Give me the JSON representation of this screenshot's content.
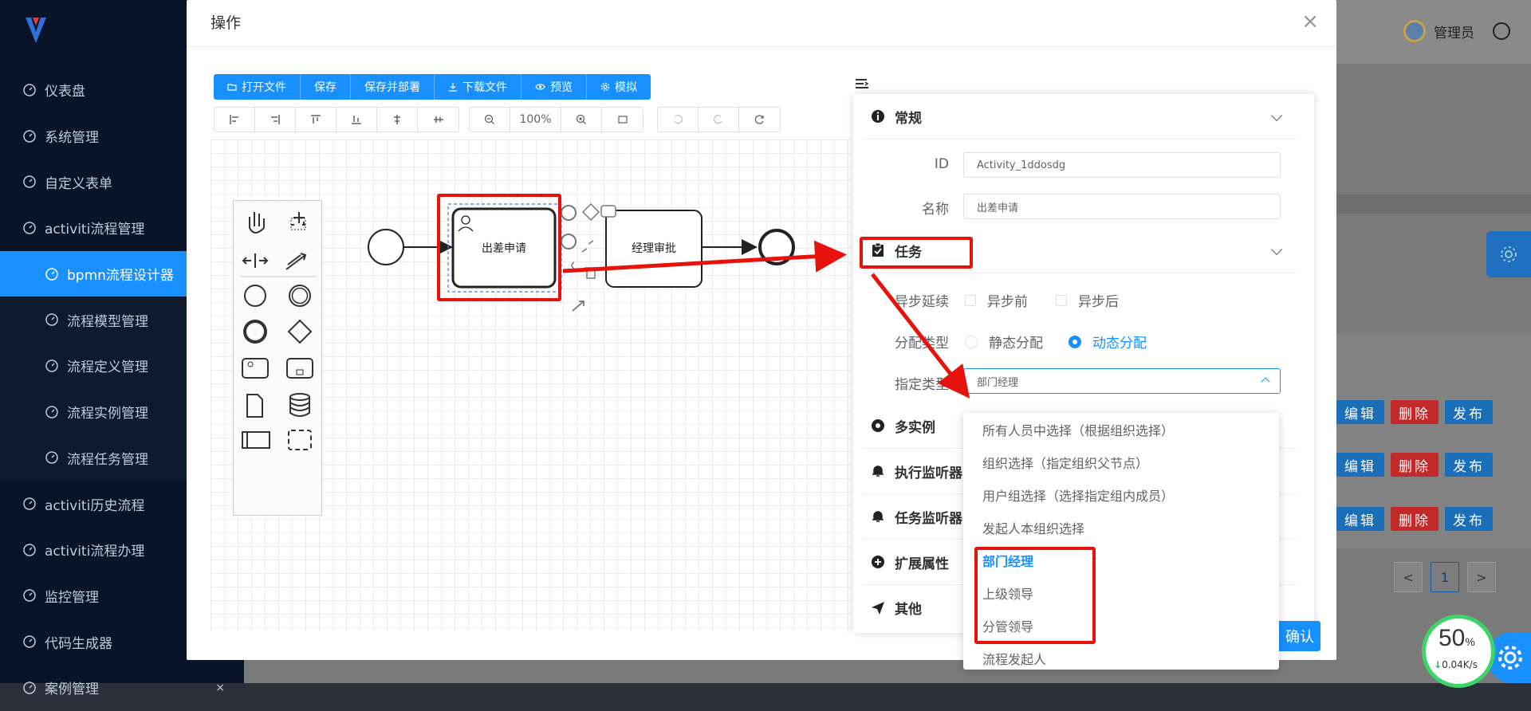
{
  "sidebar": {
    "items": [
      {
        "label": "仪表盘",
        "sub": false,
        "active": false
      },
      {
        "label": "系统管理",
        "sub": false,
        "active": false
      },
      {
        "label": "自定义表单",
        "sub": false,
        "active": false
      },
      {
        "label": "activiti流程管理",
        "sub": false,
        "active": false
      },
      {
        "label": "bpmn流程设计器",
        "sub": true,
        "active": true
      },
      {
        "label": "流程模型管理",
        "sub": true,
        "active": false
      },
      {
        "label": "流程定义管理",
        "sub": true,
        "active": false
      },
      {
        "label": "流程实例管理",
        "sub": true,
        "active": false
      },
      {
        "label": "流程任务管理",
        "sub": true,
        "active": false
      },
      {
        "label": "activiti历史流程",
        "sub": false,
        "active": false
      },
      {
        "label": "activiti流程办理",
        "sub": false,
        "active": false
      },
      {
        "label": "监控管理",
        "sub": false,
        "active": false
      },
      {
        "label": "代码生成器",
        "sub": false,
        "active": false
      },
      {
        "label": "案例管理",
        "sub": false,
        "active": false
      }
    ]
  },
  "header": {
    "user": "管理员"
  },
  "table_actions": {
    "edit": "编辑",
    "delete": "删除",
    "publish": "发布"
  },
  "pager": {
    "current": "1",
    "prev": "<",
    "next": ">"
  },
  "modal": {
    "title": "操作",
    "close": "×",
    "confirm_label": "确认"
  },
  "toolbar": {
    "open_file": "打开文件",
    "save": "保存",
    "save_deploy": "保存并部署",
    "download": "下载文件",
    "preview": "预览",
    "simulate": "模拟",
    "zoom": "100%"
  },
  "diagram": {
    "task1": "出差申请",
    "task2": "经理审批"
  },
  "panel": {
    "general": {
      "title": "常规",
      "id_label": "ID",
      "id_value": "Activity_1ddosdg",
      "name_label": "名称",
      "name_value": "出差申请"
    },
    "task": {
      "title": "任务",
      "async_label": "异步延续",
      "async_before": "异步前",
      "async_after": "异步后",
      "assign_label": "分配类型",
      "static": "静态分配",
      "dynamic": "动态分配",
      "specify_label": "指定类型",
      "specify_value": "部门经理"
    },
    "multi": "多实例",
    "exec_listener": "执行监听器",
    "task_listener": "任务监听器",
    "ext_props": "扩展属性",
    "other": "其他"
  },
  "dropdown": {
    "options": [
      "所有人员中选择（根据组织选择）",
      "组织选择（指定组织父节点）",
      "用户组选择（选择指定组内成员）",
      "发起人本组织选择",
      "部门经理",
      "上级领导",
      "分管领导",
      "流程发起人"
    ],
    "selected": "部门经理"
  },
  "net_widget": {
    "percent": "50",
    "percent_unit": "%",
    "rate": "0.04K/s"
  },
  "colors": {
    "primary": "#1890ff",
    "sidebar": "#0a1428",
    "annotation": "#e8120c",
    "danger": "#c22a2a"
  }
}
